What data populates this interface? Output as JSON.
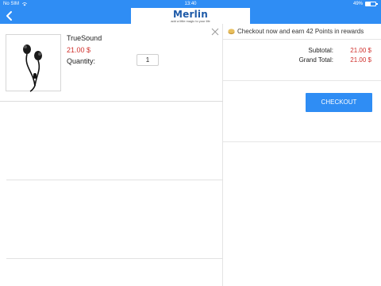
{
  "status_bar": {
    "carrier": "No SIM",
    "time": "13:40",
    "battery": "49%",
    "battery_level": 0.49
  },
  "header": {
    "logo_brand": "Merlin",
    "logo_tagline": "add a little magic to your life"
  },
  "cart": {
    "items": [
      {
        "name": "TrueSound",
        "price": "21.00 $",
        "quantity_label": "Quantity:",
        "quantity": "1"
      }
    ]
  },
  "summary": {
    "rewards_text": "Checkout now and earn 42 Points in rewards",
    "subtotal_label": "Subtotal:",
    "subtotal_value": "21.00 $",
    "grand_total_label": "Grand Total:",
    "grand_total_value": "21.00 $",
    "checkout_label": "CHECKOUT"
  },
  "colors": {
    "primary": "#2f8df4",
    "price": "#d0312d"
  }
}
